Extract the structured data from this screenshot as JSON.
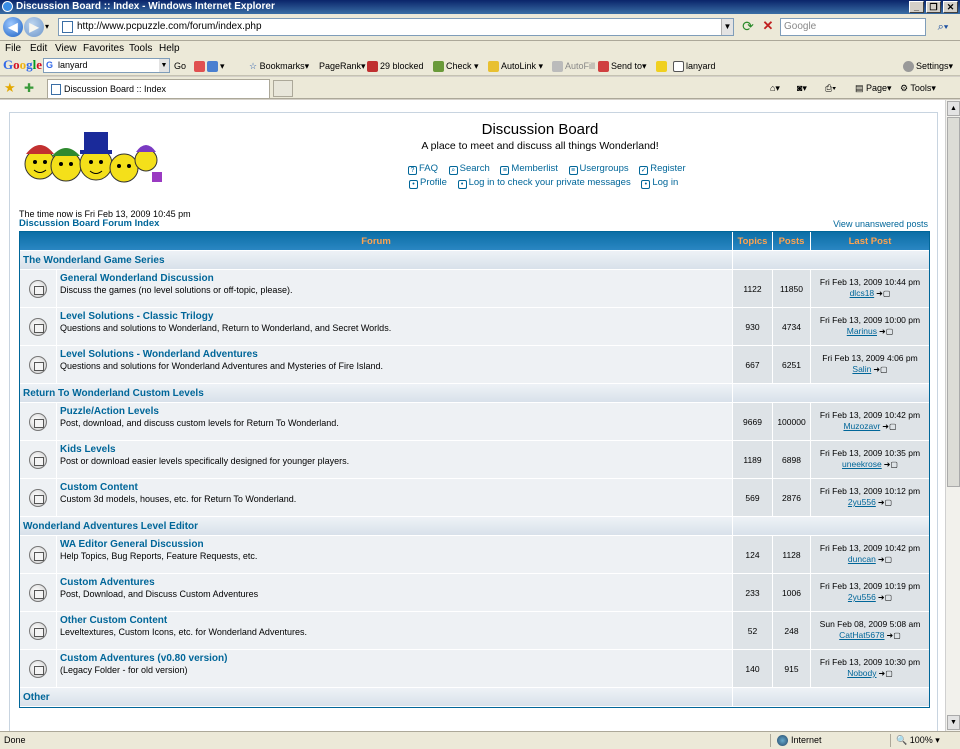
{
  "window": {
    "title": "Discussion Board :: Index - Windows Internet Explorer",
    "controls": [
      "_",
      "❐",
      "✕"
    ]
  },
  "address": {
    "url": "http://www.pcpuzzle.com/forum/index.php",
    "search_placeholder": "Google"
  },
  "menu": [
    "File",
    "Edit",
    "View",
    "Favorites",
    "Tools",
    "Help"
  ],
  "google_toolbar": {
    "logo": "Google",
    "query": "lanyard",
    "go": "Go",
    "bookmarks": "Bookmarks",
    "pagerank": "PageRank",
    "blocked": "29 blocked",
    "check": "Check",
    "autolink": "AutoLink",
    "autofill": "AutoFill",
    "sendto": "Send to",
    "lanyard": "lanyard",
    "settings": "Settings"
  },
  "tabs": {
    "active": "Discussion Board :: Index",
    "commands": {
      "page": "Page",
      "tools": "Tools"
    }
  },
  "forum": {
    "title": "Discussion Board",
    "description": "A place to meet and discuss all things Wonderland!",
    "links_top": [
      "FAQ",
      "Search",
      "Memberlist",
      "Usergroups",
      "Register"
    ],
    "links_bottom": [
      "Profile",
      "Log in to check your private messages",
      "Log in"
    ],
    "time_now": "The time now is Fri Feb 13, 2009 10:45 pm",
    "index_link": "Discussion Board Forum Index",
    "unanswered": "View unanswered posts",
    "headers": {
      "forum": "Forum",
      "topics": "Topics",
      "posts": "Posts",
      "last_post": "Last Post"
    },
    "categories": [
      {
        "name": "The Wonderland Game Series",
        "forums": [
          {
            "name": "General Wonderland Discussion",
            "desc": "Discuss the games (no level solutions or off-topic, please).",
            "topics": "1122",
            "posts": "11850",
            "last_date": "Fri Feb 13, 2009 10:44 pm",
            "last_user": "dlcs18"
          },
          {
            "name": "Level Solutions - Classic Trilogy",
            "desc": "Questions and solutions to Wonderland, Return to Wonderland, and Secret Worlds.",
            "topics": "930",
            "posts": "4734",
            "last_date": "Fri Feb 13, 2009 10:00 pm",
            "last_user": "Marinus"
          },
          {
            "name": "Level Solutions - Wonderland Adventures",
            "desc": "Questions and solutions for Wonderland Adventures and Mysteries of Fire Island.",
            "topics": "667",
            "posts": "6251",
            "last_date": "Fri Feb 13, 2009 4:06 pm",
            "last_user": "Salin"
          }
        ]
      },
      {
        "name": "Return To Wonderland Custom Levels",
        "forums": [
          {
            "name": "Puzzle/Action Levels",
            "desc": "Post, download, and discuss custom levels for Return To Wonderland.",
            "topics": "9669",
            "posts": "100000",
            "last_date": "Fri Feb 13, 2009 10:42 pm",
            "last_user": "Muzozavr"
          },
          {
            "name": "Kids Levels",
            "desc": "Post or download easier levels specifically designed for younger players.",
            "topics": "1189",
            "posts": "6898",
            "last_date": "Fri Feb 13, 2009 10:35 pm",
            "last_user": "uneekrose"
          },
          {
            "name": "Custom Content",
            "desc": "Custom 3d models, houses, etc. for Return To Wonderland.",
            "topics": "569",
            "posts": "2876",
            "last_date": "Fri Feb 13, 2009 10:12 pm",
            "last_user": "2yu556"
          }
        ]
      },
      {
        "name": "Wonderland Adventures Level Editor",
        "forums": [
          {
            "name": "WA Editor General Discussion",
            "desc": "Help Topics, Bug Reports, Feature Requests, etc.",
            "topics": "124",
            "posts": "1128",
            "last_date": "Fri Feb 13, 2009 10:42 pm",
            "last_user": "duncan"
          },
          {
            "name": "Custom Adventures",
            "desc": "Post, Download, and Discuss Custom Adventures",
            "topics": "233",
            "posts": "1006",
            "last_date": "Fri Feb 13, 2009 10:19 pm",
            "last_user": "2yu556"
          },
          {
            "name": "Other Custom Content",
            "desc": "Leveltextures, Custom Icons, etc. for Wonderland Adventures.",
            "topics": "52",
            "posts": "248",
            "last_date": "Sun Feb 08, 2009 5:08 am",
            "last_user": "CatHat5678"
          },
          {
            "name": "Custom Adventures (v0.80 version)",
            "desc": "(Legacy Folder - for old version)",
            "topics": "140",
            "posts": "915",
            "last_date": "Fri Feb 13, 2009 10:30 pm",
            "last_user": "Nobody"
          }
        ]
      },
      {
        "name": "Other",
        "forums": []
      }
    ]
  },
  "status": {
    "left": "Done",
    "zone": "Internet",
    "zoom": "100%"
  },
  "colors": {
    "link": "#006699",
    "header_text": "#ffa34f",
    "row_light": "#eef1f4",
    "row_dark": "#dee3e7"
  }
}
